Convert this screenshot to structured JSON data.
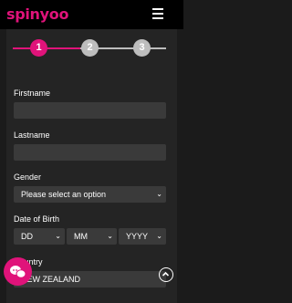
{
  "header": {
    "logo_text": "spinyoo"
  },
  "stepper": {
    "steps": [
      "1",
      "2",
      "3"
    ],
    "active_color": "#e0137a",
    "inactive_color": "#bdbdbd"
  },
  "form": {
    "firstname_label": "Firstname",
    "firstname_value": "",
    "lastname_label": "Lastname",
    "lastname_value": "",
    "gender_label": "Gender",
    "gender_value": "Please select an option",
    "dob_label": "Date of Birth",
    "dob_day": "DD",
    "dob_month": "MM",
    "dob_year": "YYYY",
    "country_label": "Country",
    "country_value": "NEW ZEALAND"
  },
  "icons": {
    "menu": "hamburger-icon",
    "chat": "chat-icon",
    "scroll_top": "chevron-up-icon"
  }
}
